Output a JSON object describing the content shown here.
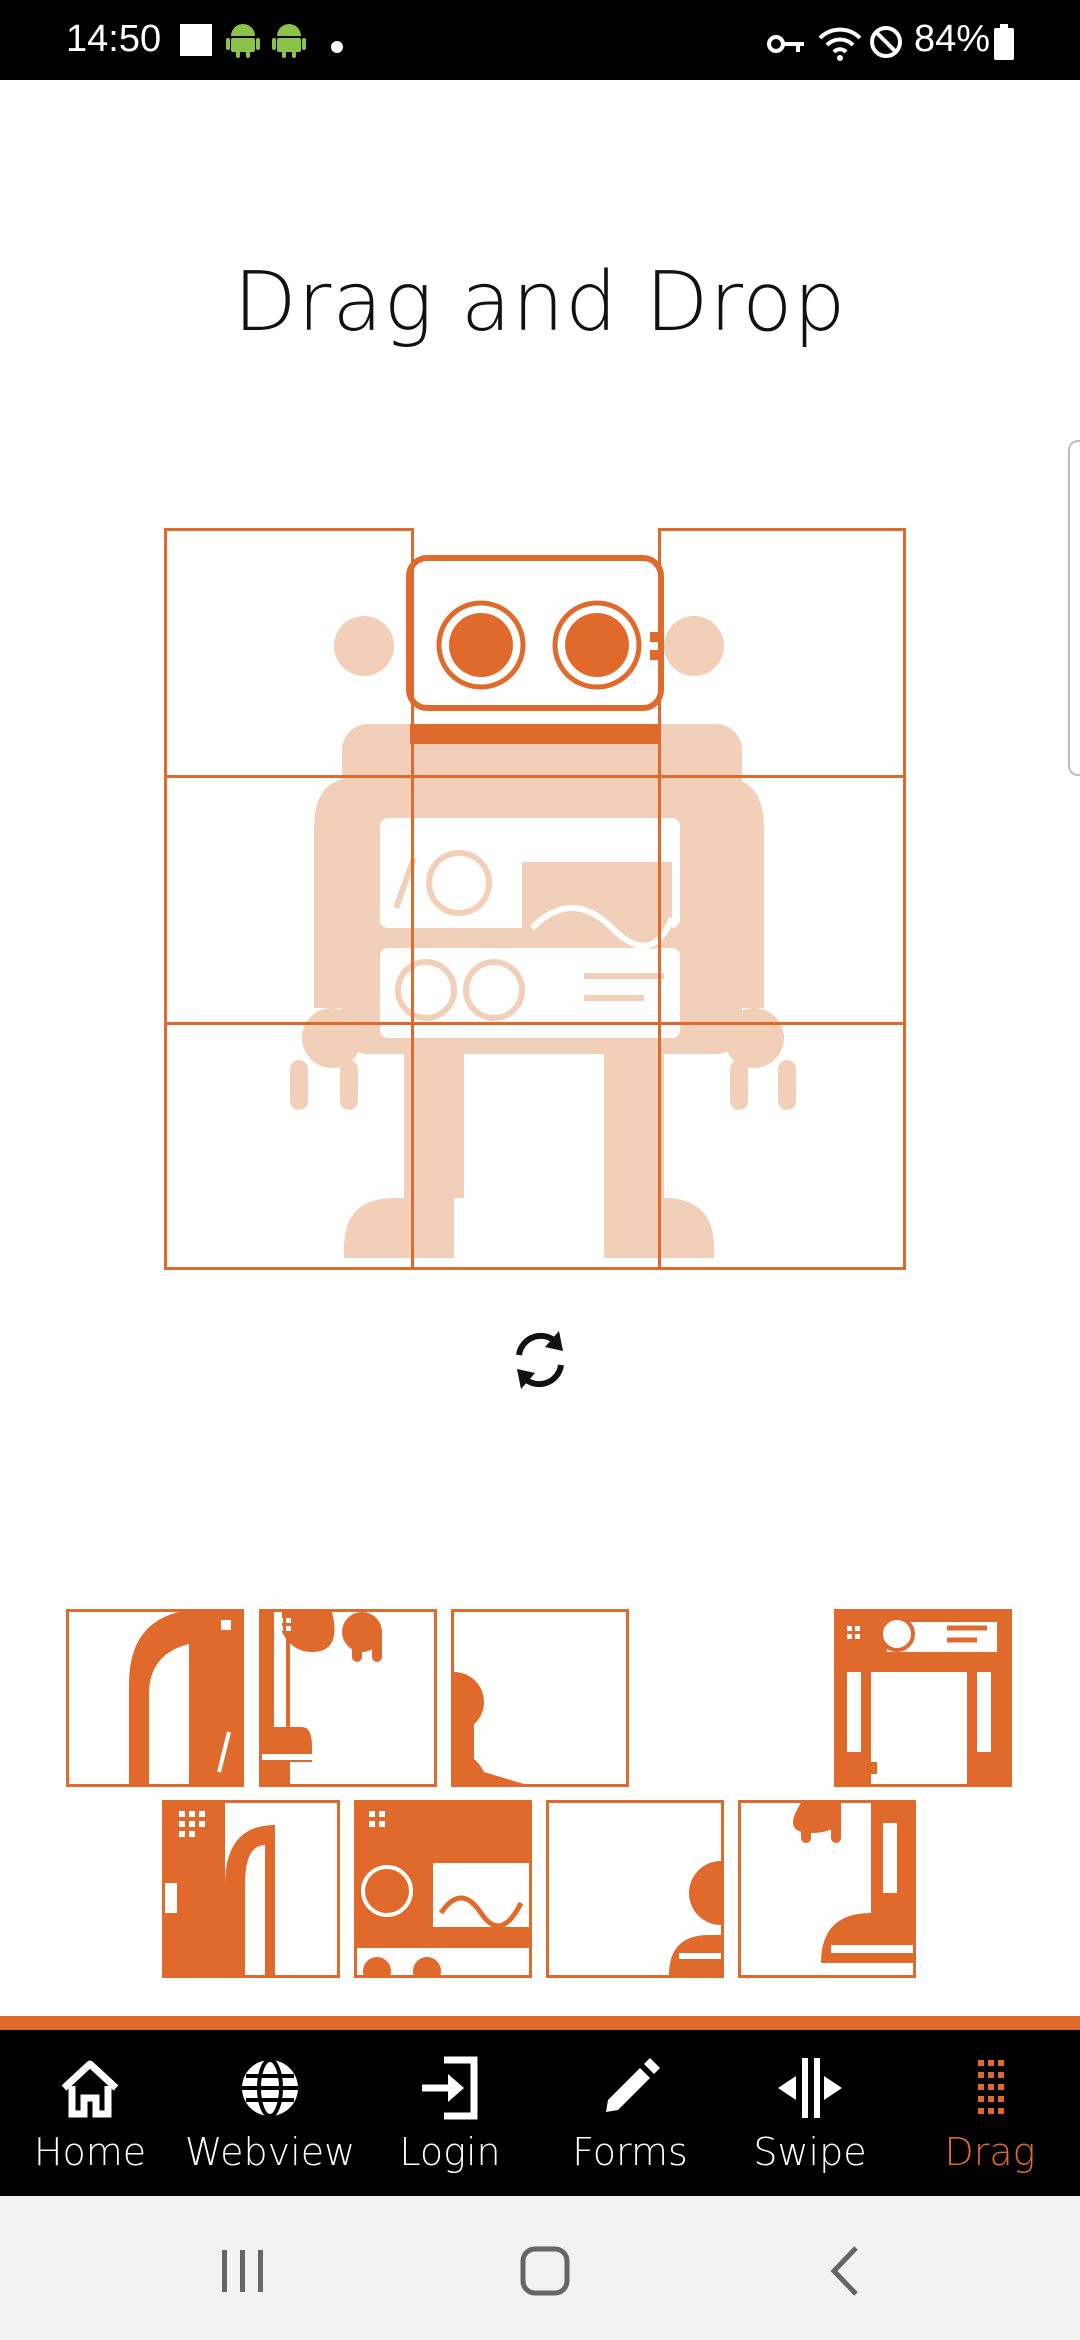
{
  "status_bar": {
    "time": "14:50",
    "battery": "84%",
    "icons": [
      "image-icon",
      "android-icon",
      "android-icon",
      "dot-icon",
      "vpn-key-icon",
      "wifi-icon",
      "do-not-disturb-icon",
      "battery-icon"
    ]
  },
  "page": {
    "title": "Drag and Drop"
  },
  "board": {
    "rows": 3,
    "cols": 3,
    "filled_slots": 0
  },
  "refresh": {
    "icon": "refresh-icon"
  },
  "pieces": {
    "count": 8
  },
  "bottom_nav": {
    "items": [
      {
        "label": "Home",
        "icon": "home-icon",
        "active": false
      },
      {
        "label": "Webview",
        "icon": "globe-icon",
        "active": false
      },
      {
        "label": "Login",
        "icon": "login-icon",
        "active": false
      },
      {
        "label": "Forms",
        "icon": "pencil-icon",
        "active": false
      },
      {
        "label": "Swipe",
        "icon": "swipe-icon",
        "active": false
      },
      {
        "label": "Drag",
        "icon": "grid-dots-icon",
        "active": true
      }
    ]
  },
  "colors": {
    "accent": "#e06a2c",
    "faded": "#f2cfb8",
    "status_bar": "#000000",
    "nav_bar": "#000000"
  }
}
